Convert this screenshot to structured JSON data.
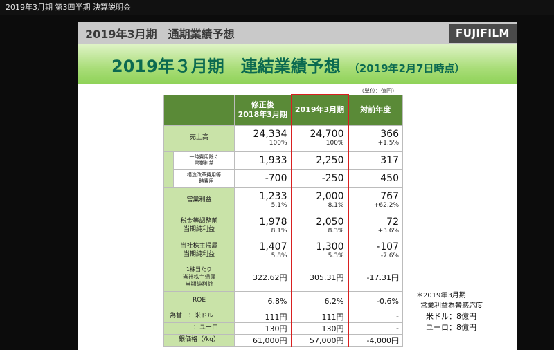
{
  "window": {
    "title": "2019年3月期 第3四半期 決算説明会"
  },
  "slide": {
    "header_title": "2019年3月期　通期業績予想",
    "logo": "FUJIFILM",
    "banner_title": "2019年３月期　連結業績予想",
    "banner_sub": "（2019年2月7日時点）",
    "unit": "（単位：億円）"
  },
  "table": {
    "headers": [
      "修正後\n2018年3月期",
      "2019年3月期",
      "対前年度"
    ],
    "rows": {
      "sales": {
        "label": "売上高",
        "v1": "24,334",
        "p1": "100%",
        "v2": "24,700",
        "p2": "100%",
        "v3": "366",
        "p3": "+1.5%"
      },
      "op_ex": {
        "label": "一時費用除く\n営業利益",
        "v1": "1,933",
        "v2": "2,250",
        "v3": "317"
      },
      "restructure": {
        "label": "構造改革費用等\n一時費用",
        "v1": "-700",
        "v2": "-250",
        "v3": "450"
      },
      "op": {
        "label": "営業利益",
        "v1": "1,233",
        "p1": "5.1%",
        "v2": "2,000",
        "p2": "8.1%",
        "v3": "767",
        "p3": "+62.2%"
      },
      "pretax": {
        "label": "税金等調整前\n当期純利益",
        "v1": "1,978",
        "p1": "8.1%",
        "v2": "2,050",
        "p2": "8.3%",
        "v3": "72",
        "p3": "+3.6%"
      },
      "net": {
        "label": "当社株主帰属\n当期純利益",
        "v1": "1,407",
        "p1": "5.8%",
        "v2": "1,300",
        "p2": "5.3%",
        "v3": "-107",
        "p3": "-7.6%"
      },
      "eps": {
        "label": "1株当たり\n当社株主帰属\n当期純利益",
        "v1": "322.62円",
        "v2": "305.31円",
        "v3": "-17.31円"
      },
      "roe": {
        "label": "ROE",
        "v1": "6.8%",
        "v2": "6.2%",
        "v3": "-0.6%"
      },
      "fx_usd": {
        "label": "為替　：米ドル",
        "v1": "111円",
        "v2": "111円",
        "v3": "-"
      },
      "fx_eur": {
        "label": "：ユーロ",
        "v1": "130円",
        "v2": "130円",
        "v3": "-"
      },
      "silver": {
        "label": "銀価格（/kg）",
        "v1": "61,000円",
        "v2": "57,000円",
        "v3": "-4,000円"
      }
    }
  },
  "note": {
    "line1": "＊2019年3月期",
    "line2": "営業利益為替感応度",
    "line3": "米ドル：8億円",
    "line4": "ユーロ：8億円"
  },
  "colors": {
    "header_green": "#5a8a37",
    "label_green": "#c9e3a8",
    "banner_text": "#0b6a50",
    "highlight_red": "#d92020"
  }
}
